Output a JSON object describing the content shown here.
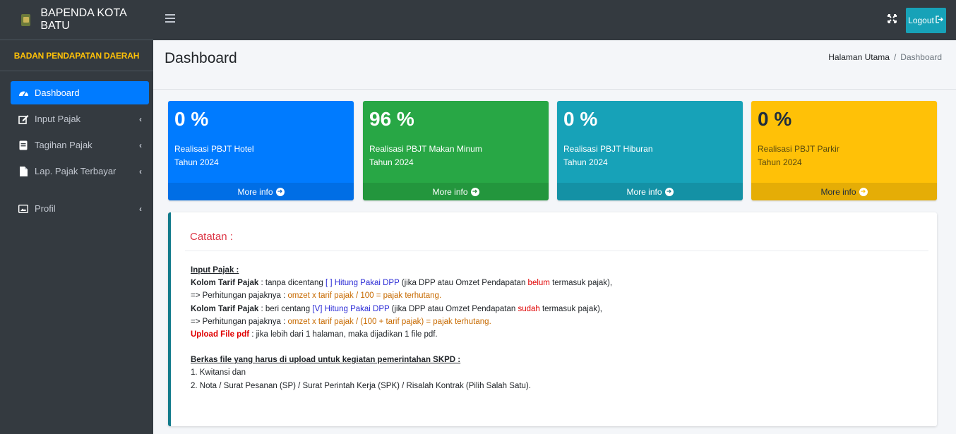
{
  "brand": {
    "title": "BAPENDA KOTA BATU",
    "org": "BADAN PENDAPATAN DAERAH"
  },
  "sidebar": {
    "items": [
      {
        "label": "Dashboard",
        "icon": "dashboard-icon"
      },
      {
        "label": "Input Pajak",
        "icon": "edit-icon"
      },
      {
        "label": "Tagihan Pajak",
        "icon": "receipt-icon"
      },
      {
        "label": "Lap. Pajak Terbayar",
        "icon": "file-icon"
      },
      {
        "label": "Profil",
        "icon": "id-card-icon"
      }
    ]
  },
  "topbar": {
    "logout_label": "Logout"
  },
  "header": {
    "title": "Dashboard",
    "breadcrumb_home": "Halaman Utama",
    "breadcrumb_sep": "/",
    "breadcrumb_current": "Dashboard"
  },
  "boxes": [
    {
      "value": "0 %",
      "label": "Realisasi PBJT Hotel",
      "year": "Tahun 2024",
      "more": "More info",
      "color": "#007bff"
    },
    {
      "value": "96 %",
      "label": "Realisasi PBJT Makan Minum",
      "year": "Tahun 2024",
      "more": "More info",
      "color": "#28a745"
    },
    {
      "value": "0 %",
      "label": "Realisasi PBJT Hiburan",
      "year": "Tahun 2024",
      "more": "More info",
      "color": "#17a2b8"
    },
    {
      "value": "0 %",
      "label": "Realisasi PBJT Parkir",
      "year": "Tahun 2024",
      "more": "More info",
      "color": "#ffc107"
    }
  ],
  "note": {
    "title": "Catatan :",
    "heading1": "Input Pajak :",
    "l1_a": "Kolom Tarif Pajak",
    "l1_b": " : tanpa dicentang ",
    "l1_c": "[ ] Hitung Pakai DPP",
    "l1_d": " (jika DPP atau Omzet Pendapatan ",
    "l1_e": "belum",
    "l1_f": " termasuk pajak),",
    "l2_a": "=> Perhitungan pajaknya : ",
    "l2_b": "omzet x tarif pajak / 100 = pajak terhutang.",
    "l3_a": "Kolom Tarif Pajak",
    "l3_b": " : beri centang ",
    "l3_c": "[V] Hitung Pakai DPP",
    "l3_d": " (jika DPP atau Omzet Pendapatan ",
    "l3_e": "sudah",
    "l3_f": " termasuk pajak),",
    "l4_a": "=> Perhitungan pajaknya : ",
    "l4_b": "omzet x tarif pajak / (100 + tarif pajak) = pajak terhutang.",
    "l5_a": "Upload File pdf",
    "l5_b": " : jika lebih dari 1 halaman, maka dijadikan 1 file pdf.",
    "heading2": "Berkas file yang harus di upload untuk kegiatan pemerintahan SKPD :",
    "item1": "1. Kwitansi dan",
    "item2": "2. Nota / Surat Pesanan (SP) / Surat Perintah Kerja (SPK) / Risalah Kontrak (Pilih Salah Satu)."
  }
}
